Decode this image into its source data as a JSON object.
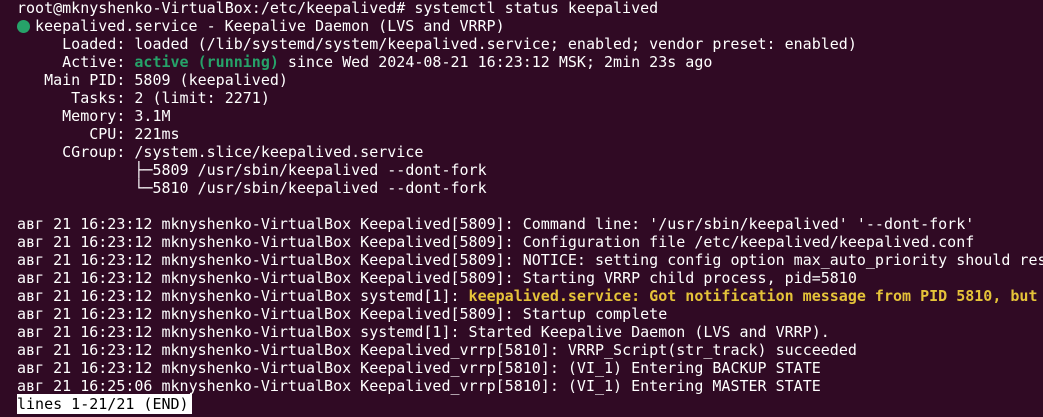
{
  "terminal": {
    "prompt": "root@mknyshenko-VirtualBox:/etc/keepalived# systemctl status keepalived",
    "service_header": "keepalived.service - Keepalive Daemon (LVS and VRRP)",
    "loaded": "     Loaded: loaded (/lib/systemd/system/keepalived.service; enabled; vendor preset: enabled)",
    "active_prefix": "     Active: ",
    "active_state": "active (running)",
    "active_suffix": " since Wed 2024-08-21 16:23:12 MSK; 2min 23s ago",
    "main_pid": "   Main PID: 5809 (keepalived)",
    "tasks": "      Tasks: 2 (limit: 2271)",
    "memory": "     Memory: 3.1M",
    "cpu": "        CPU: 221ms",
    "cgroup": "     CGroup: /system.slice/keepalived.service",
    "cgroup_child1": "             ├─5809 /usr/sbin/keepalived --dont-fork",
    "cgroup_child2": "             └─5810 /usr/sbin/keepalived --dont-fork",
    "logs": [
      {
        "prefix": "авг 21 16:23:12 mknyshenko-VirtualBox Keepalived[5809]: ",
        "text": "Command line: '/usr/sbin/keepalived' '--dont-fork'"
      },
      {
        "prefix": "авг 21 16:23:12 mknyshenko-VirtualBox Keepalived[5809]: ",
        "text": "Configuration file /etc/keepalived/keepalived.conf"
      },
      {
        "prefix": "авг 21 16:23:12 mknyshenko-VirtualBox Keepalived[5809]: ",
        "text": "NOTICE: setting config option max_auto_priority should res"
      },
      {
        "prefix": "авг 21 16:23:12 mknyshenko-VirtualBox Keepalived[5809]: ",
        "text": "Starting VRRP child process, pid=5810"
      },
      {
        "prefix": "авг 21 16:23:12 mknyshenko-VirtualBox systemd[1]: ",
        "text": "keepalived.service: Got notification message from PID 5810, but"
      },
      {
        "prefix": "авг 21 16:23:12 mknyshenko-VirtualBox Keepalived[5809]: ",
        "text": "Startup complete"
      },
      {
        "prefix": "авг 21 16:23:12 mknyshenko-VirtualBox systemd[1]: ",
        "text": "Started Keepalive Daemon (LVS and VRRP)."
      },
      {
        "prefix": "авг 21 16:23:12 mknyshenko-VirtualBox Keepalived_vrrp[5810]: ",
        "text": "VRRP_Script(str_track) succeeded"
      },
      {
        "prefix": "авг 21 16:23:12 mknyshenko-VirtualBox Keepalived_vrrp[5810]: ",
        "text": "(VI_1) Entering BACKUP STATE"
      },
      {
        "prefix": "авг 21 16:25:06 mknyshenko-VirtualBox Keepalived_vrrp[5810]: ",
        "text": "(VI_1) Entering MASTER STATE"
      }
    ],
    "pager_status": "lines 1-21/21 (END)"
  },
  "colors": {
    "background": "#300a24",
    "foreground": "#ffffff",
    "active_green": "#26a269",
    "warning_yellow": "#e5c339",
    "status_dot": "#26a269"
  },
  "icons": {
    "status_dot": "green-circle-status-icon"
  }
}
